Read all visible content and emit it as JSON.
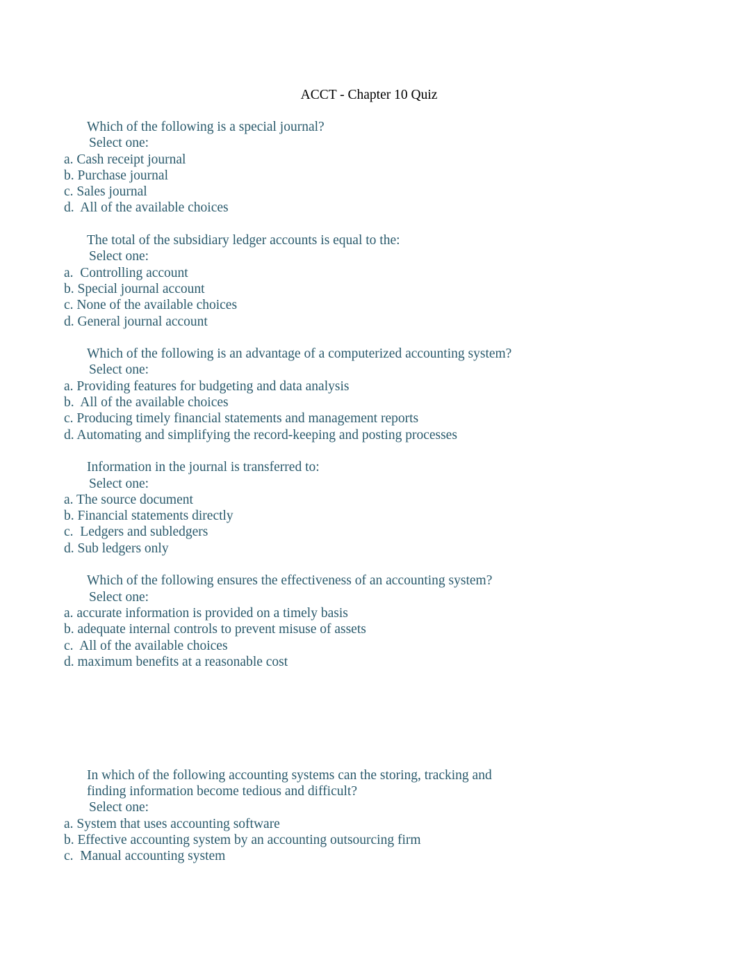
{
  "document": {
    "title": "ACCT - Chapter 10 Quiz",
    "text_color": "#2A5A6C",
    "title_color": "#000000",
    "background_color": "#ffffff",
    "select_one_label": "Select one:"
  },
  "questions": [
    {
      "prompt": "Which of the following is a special journal?",
      "select_label": "Select one:",
      "options": [
        "a. Cash receipt journal",
        "b. Purchase journal",
        "c. Sales journal",
        "d.  All of the available choices"
      ]
    },
    {
      "prompt": "The total of the subsidiary ledger accounts is equal to the:",
      "select_label": "Select one:",
      "options": [
        "a.  Controlling account",
        "b. Special journal account",
        "c. None of the available choices",
        "d. General journal account"
      ]
    },
    {
      "prompt": "Which of the following is an advantage of a computerized accounting system?",
      "select_label": "Select one:",
      "options": [
        "a. Providing features for budgeting and data analysis",
        "b.  All of the available choices",
        "c. Producing timely financial statements and management reports",
        "d. Automating and simplifying the record-keeping and posting processes"
      ]
    },
    {
      "prompt": "Information in the journal is transferred to:",
      "select_label": "Select one:",
      "options": [
        "a. The source document",
        "b. Financial statements directly",
        "c.  Ledgers and subledgers",
        "d. Sub ledgers only"
      ]
    },
    {
      "prompt": "Which of the following ensures the effectiveness of an accounting system?",
      "select_label": "Select one:",
      "options": [
        "a. accurate information is provided on a timely basis",
        "b. adequate internal controls to prevent misuse of assets",
        "c.  All of the available choices",
        "d. maximum benefits at a reasonable cost"
      ]
    },
    {
      "prompt": "In which of the following accounting systems can the storing, tracking and finding information become tedious and difficult?",
      "select_label": "Select one:",
      "options": [
        "a. System that uses accounting software",
        "b. Effective accounting system by an accounting outsourcing firm",
        "c.  Manual accounting system"
      ]
    }
  ]
}
